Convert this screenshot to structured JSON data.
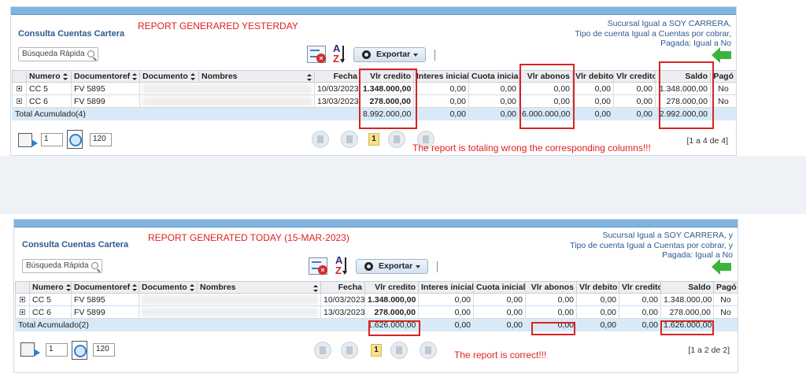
{
  "colors": {
    "accent_bar": "#7fb4de",
    "title_blue": "#2d5a91",
    "annotation_red": "#e0201e",
    "total_row": "#d8e9f7"
  },
  "icons": [
    "search-icon",
    "export-excel-icon",
    "sort-az-icon",
    "gear-icon",
    "back-arrow-icon",
    "go-to-page-icon",
    "find-icon",
    "first-page-icon",
    "prev-page-icon",
    "next-page-icon",
    "last-page-icon",
    "expand-row-icon"
  ],
  "columns": [
    "Numero",
    "Documentoref",
    "Documento",
    "Nombres",
    "Fecha",
    "Vlr credito",
    "Interes inicial",
    "Cuota inicial",
    "Vlr abonos",
    "Vlr debito",
    "Vlr credito",
    "Saldo",
    "Pagó"
  ],
  "reports": [
    {
      "title": "Consulta Cuentas Cartera",
      "annotation": "REPORT GENERARED YESTERDAY",
      "filters": [
        "Sucursal Igual a SOY CARRERA,",
        "Tipo de cuenta Igual a Cuentas por cobrar,",
        "Pagada: Igual a No"
      ],
      "search_placeholder": "Búsqueda Rápida",
      "export_label": "Exportar",
      "rows": [
        {
          "numero": "CC 5",
          "documentoref": "FV 5895",
          "fecha": "10/03/2023",
          "vlr_credito": "1.348.000,00",
          "interes": "0,00",
          "cuota": "0,00",
          "abonos": "0,00",
          "debito": "0,00",
          "credito2": "0,00",
          "saldo": "1.348.000,00",
          "pago": "No"
        },
        {
          "numero": "CC 6",
          "documentoref": "FV 5899",
          "fecha": "13/03/2023",
          "vlr_credito": "278.000,00",
          "interes": "0,00",
          "cuota": "0,00",
          "abonos": "0,00",
          "debito": "0,00",
          "credito2": "0,00",
          "saldo": "278.000,00",
          "pago": "No"
        }
      ],
      "total": {
        "label": "Total Acumulado(4)",
        "vlr_credito": "8.992.000,00",
        "interes": "0,00",
        "cuota": "0,00",
        "abonos": "6.000.000,00",
        "debito": "0,00",
        "credito2": "0,00",
        "saldo": "2.992.000,00"
      },
      "pager": {
        "page_input": "1",
        "page_size": "120",
        "current_page": "1",
        "range": "[1 a 4 de 4]"
      },
      "bottom_note": "The report is totaling wrong the corresponding columns!!!"
    },
    {
      "title": "Consulta Cuentas Cartera",
      "annotation": "REPORT GENERATED TODAY (15-MAR-2023)",
      "filters": [
        "Sucursal Igual a SOY CARRERA, y",
        "Tipo de cuenta Igual a Cuentas por cobrar, y",
        "Pagada: Igual a No"
      ],
      "search_placeholder": "Búsqueda Rápida",
      "export_label": "Exportar",
      "rows": [
        {
          "numero": "CC 5",
          "documentoref": "FV 5895",
          "fecha": "10/03/2023",
          "vlr_credito": "1.348.000,00",
          "interes": "0,00",
          "cuota": "0,00",
          "abonos": "0,00",
          "debito": "0,00",
          "credito2": "0,00",
          "saldo": "1.348.000,00",
          "pago": "No"
        },
        {
          "numero": "CC 6",
          "documentoref": "FV 5899",
          "fecha": "13/03/2023",
          "vlr_credito": "278.000,00",
          "interes": "0,00",
          "cuota": "0,00",
          "abonos": "0,00",
          "debito": "0,00",
          "credito2": "0,00",
          "saldo": "278.000,00",
          "pago": "No"
        }
      ],
      "total": {
        "label": "Total Acumulado(2)",
        "vlr_credito": "1.626.000,00",
        "interes": "0,00",
        "cuota": "0,00",
        "abonos": "0,00",
        "debito": "0,00",
        "credito2": "0,00",
        "saldo": "1.626.000,00"
      },
      "pager": {
        "page_input": "1",
        "page_size": "120",
        "current_page": "1",
        "range": "[1 a 2 de 2]"
      },
      "bottom_note": "The report is correct!!!"
    }
  ]
}
